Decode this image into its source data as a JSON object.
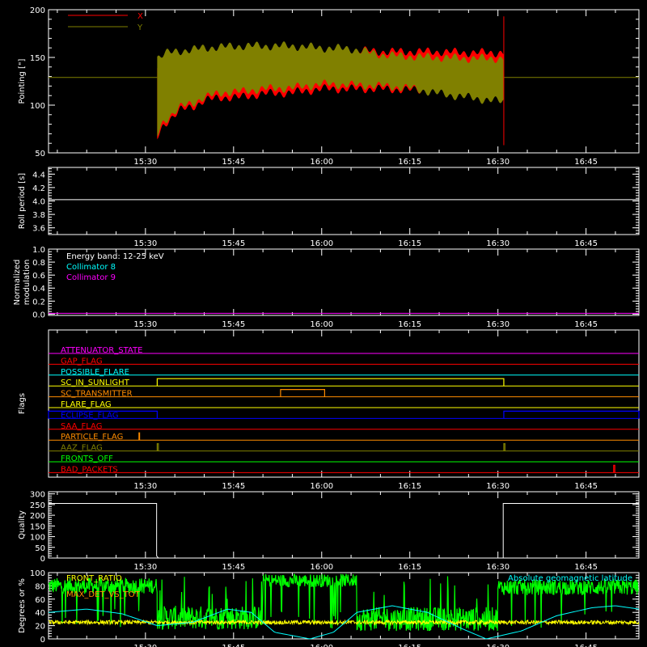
{
  "time_axis": {
    "tick_labels": [
      "15:30",
      "15:45",
      "16:00",
      "16:15",
      "16:30",
      "16:45"
    ],
    "tick_minutes": [
      930,
      945,
      960,
      975,
      990,
      1005
    ],
    "range_minutes": [
      913.5,
      1014
    ]
  },
  "chart_data": [
    {
      "id": "pointing",
      "type": "line",
      "ylabel": "Pointing [\"]",
      "ylim": [
        50,
        200
      ],
      "yticks": [
        50,
        100,
        150,
        200
      ],
      "legend": [
        {
          "name": "X",
          "color": "#ff0000"
        },
        {
          "name": "Y",
          "color": "#808000"
        }
      ],
      "baseline": 129,
      "data_start_min": 932,
      "data_end_min": 991,
      "series": [
        {
          "name": "X",
          "color": "#ff0000",
          "x": [
            932,
            933,
            934,
            936,
            938,
            940,
            943,
            946,
            950,
            955,
            960,
            965,
            970,
            975,
            980,
            985,
            990,
            991
          ],
          "upper": [
            138,
            145,
            142,
            146,
            150,
            154,
            157,
            160,
            160,
            160,
            159,
            158,
            156,
            156,
            156,
            155,
            155,
            155
          ],
          "lower": [
            65,
            78,
            85,
            95,
            98,
            105,
            108,
            108,
            112,
            113,
            117,
            117,
            117,
            116,
            115,
            112,
            110,
            110
          ]
        },
        {
          "name": "Y",
          "color": "#808000",
          "x": [
            932,
            933,
            934,
            936,
            938,
            940,
            943,
            946,
            950,
            955,
            960,
            965,
            970,
            975,
            980,
            985,
            990,
            991
          ],
          "upper": [
            150,
            153,
            155,
            157,
            158,
            160,
            161,
            162,
            162,
            162,
            160,
            159,
            153,
            151,
            150,
            149,
            149,
            149
          ],
          "lower": [
            68,
            82,
            88,
            98,
            102,
            108,
            113,
            114,
            117,
            118,
            122,
            121,
            120,
            118,
            112,
            108,
            104,
            104
          ]
        }
      ],
      "spike": {
        "x": 991,
        "high": 193,
        "low": 58
      }
    },
    {
      "id": "roll_period",
      "type": "line",
      "ylabel": "Roll period [s]",
      "ylim": [
        3.5,
        4.5
      ],
      "yticks": [
        3.6,
        3.8,
        4.0,
        4.2,
        4.4
      ],
      "ytick_labels": [
        "3.6",
        "3.8",
        "4.0",
        "4.2",
        "4.4"
      ],
      "series": [
        {
          "name": "",
          "x": [
            913.5,
            1014
          ],
          "y": [
            4.02,
            4.02
          ],
          "color": "#ffffff"
        }
      ]
    },
    {
      "id": "modulation",
      "type": "line",
      "ylabel": "Normalized modulation",
      "ylim": [
        -0.02,
        1.0
      ],
      "yticks": [
        0.0,
        0.2,
        0.4,
        0.6,
        0.8,
        1.0
      ],
      "ytick_labels": [
        "0.0",
        "0.2",
        "0.4",
        "0.6",
        "0.8",
        "1.0"
      ],
      "legend": [
        {
          "name": "Energy band: 12-25 keV",
          "color": "#ffffff"
        },
        {
          "name": "Collimator 8",
          "color": "#00ffff"
        },
        {
          "name": "Collimator 9",
          "color": "#ff00ff"
        }
      ],
      "series": [
        {
          "name": "Collimator 9",
          "x": [
            913.5,
            1014
          ],
          "y": [
            0.0,
            0.0
          ],
          "color": "#ff00ff"
        }
      ]
    },
    {
      "id": "flags",
      "type": "line",
      "ylabel": "Flags",
      "flags": [
        {
          "name": "ATTENUATOR_STATE",
          "color": "#ff00ff",
          "segments": []
        },
        {
          "name": "GAP_FLAG",
          "color": "#ff0000",
          "segments": []
        },
        {
          "name": "POSSIBLE_FLARE",
          "color": "#00ffff",
          "segments": []
        },
        {
          "name": "SC_IN_SUNLIGHT",
          "color": "#ffff00",
          "segments": [
            [
              932,
              991
            ]
          ]
        },
        {
          "name": "SC_TRANSMITTER",
          "color": "#ff8c00",
          "segments": [
            [
              953,
              960.5
            ]
          ]
        },
        {
          "name": "FLARE_FLAG",
          "color": "#ffff00",
          "segments": []
        },
        {
          "name": "ECLIPSE_FLAG",
          "color": "#0000ff",
          "segments": [
            [
              913.5,
              932
            ],
            [
              991,
              1014
            ]
          ]
        },
        {
          "name": "SAA_FLAG",
          "color": "#ff0000",
          "segments": []
        },
        {
          "name": "PARTICLE_FLAG",
          "color": "#ff8c00",
          "segments": [
            [
              928.9,
              929.0
            ]
          ]
        },
        {
          "name": "AAZ_FLAG",
          "color": "#808000",
          "segments": [
            [
              932,
              932.2
            ],
            [
              991,
              991.2
            ]
          ]
        },
        {
          "name": "FRONTS_OFF",
          "color": "#00ff00",
          "segments": []
        },
        {
          "name": "BAD_PACKETS",
          "color": "#ff0000",
          "segments": [
            [
              1009.7,
              1009.9
            ]
          ]
        }
      ]
    },
    {
      "id": "quality",
      "type": "line",
      "ylabel": "Quality",
      "ylim": [
        0,
        310
      ],
      "yticks": [
        0,
        50,
        100,
        150,
        200,
        250,
        300
      ],
      "series": [
        {
          "name": "",
          "color": "#ffffff",
          "x": [
            913.5,
            931.9,
            931.9,
            932.2,
            932.2,
            990.9,
            990.9,
            1014
          ],
          "y": [
            255,
            255,
            10,
            0,
            0,
            0,
            255,
            255
          ]
        }
      ]
    },
    {
      "id": "fronts",
      "type": "line",
      "ylabel": "Degrees or %",
      "ylim": [
        0,
        100
      ],
      "yticks": [
        0,
        20,
        40,
        60,
        80,
        100
      ],
      "legend": [
        {
          "name": "FRONT_RATIO",
          "color": "#ffff00"
        },
        {
          "name": "MAX_DET_VS_TOT",
          "color": "#ff8c00"
        },
        {
          "name": "Absolute geomagnetic latitude",
          "color": "#00ffff"
        }
      ],
      "series": [
        {
          "name": "FRONT_RATIO",
          "color": "#00ff00",
          "segments": [
            {
              "x": [
                913.5,
                932
              ],
              "level": 80,
              "spread": 12
            },
            {
              "x": [
                932,
                950
              ],
              "level": 32,
              "spread": 18
            },
            {
              "x": [
                950,
                966
              ],
              "level": 88,
              "spread": 10
            },
            {
              "x": [
                966,
                990
              ],
              "level": 30,
              "spread": 18
            },
            {
              "x": [
                990,
                1014
              ],
              "level": 78,
              "spread": 12
            }
          ]
        },
        {
          "name": "MAX_DET_VS_TOT",
          "color": "#ffff00",
          "segments": [
            {
              "x": [
                913.5,
                1014
              ],
              "level": 25,
              "spread": 3
            }
          ]
        },
        {
          "name": "Absolute geomagnetic latitude",
          "color": "#00ffff",
          "x": [
            913.5,
            920,
            926,
            932,
            938,
            944,
            948,
            952,
            958,
            962,
            966,
            972,
            978,
            984,
            988,
            994,
            1000,
            1006,
            1010,
            1014
          ],
          "y": [
            40,
            45,
            38,
            20,
            25,
            45,
            40,
            10,
            0,
            10,
            40,
            50,
            40,
            15,
            0,
            12,
            35,
            47,
            50,
            45
          ]
        }
      ]
    }
  ]
}
